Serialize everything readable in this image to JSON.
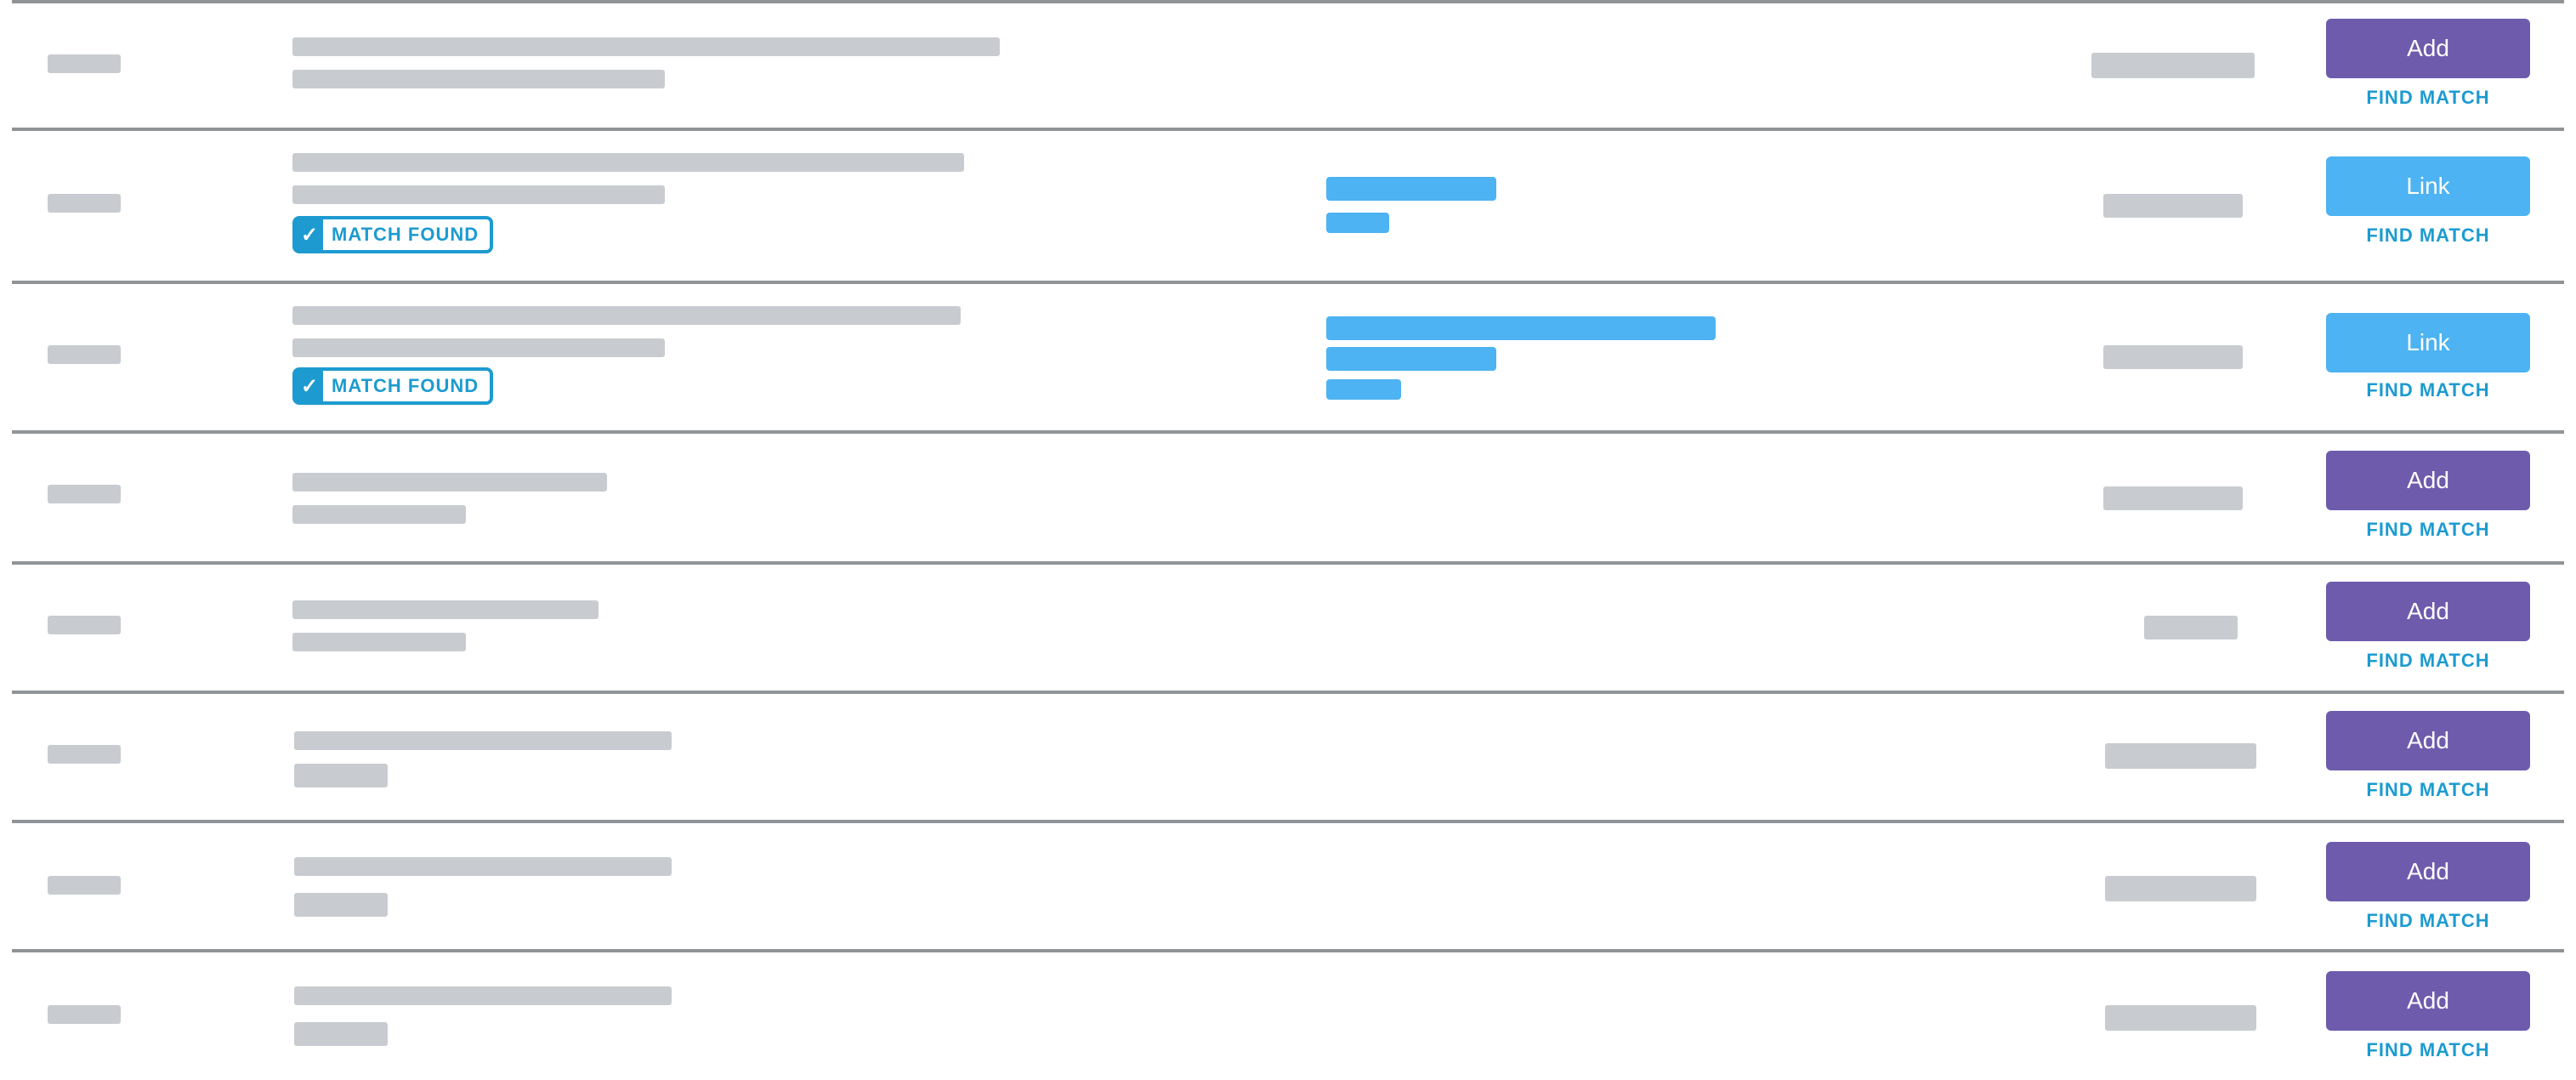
{
  "rows": [
    {
      "status": "",
      "action_label": "Add",
      "action_style": "add",
      "find_label": "FIND MATCH"
    },
    {
      "status": "MATCH FOUND",
      "action_label": "Link",
      "action_style": "link",
      "find_label": "FIND MATCH"
    },
    {
      "status": "MATCH FOUND",
      "action_label": "Link",
      "action_style": "link",
      "find_label": "FIND MATCH"
    },
    {
      "status": "",
      "action_label": "Add",
      "action_style": "add",
      "find_label": "FIND MATCH"
    },
    {
      "status": "",
      "action_label": "Add",
      "action_style": "add",
      "find_label": "FIND MATCH"
    },
    {
      "status": "",
      "action_label": "Add",
      "action_style": "add",
      "find_label": "FIND MATCH"
    },
    {
      "status": "",
      "action_label": "Add",
      "action_style": "add",
      "find_label": "FIND MATCH"
    },
    {
      "status": "",
      "action_label": "Add",
      "action_style": "add",
      "find_label": "FIND MATCH"
    }
  ],
  "colors": {
    "add_button": "#6e5bac",
    "link_button": "#4db3f2",
    "find_match_text": "#1d9bd0",
    "redacted_placeholder": "#c8ccd0",
    "row_divider": "#8f9498"
  },
  "icons": {
    "match_found": "check-icon"
  }
}
